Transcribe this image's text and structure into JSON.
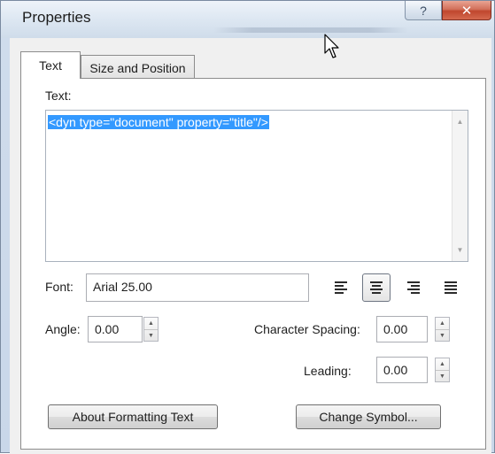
{
  "window": {
    "title": "Properties",
    "help_glyph": "?",
    "close_glyph": "✕"
  },
  "tabs": [
    {
      "label": "Text",
      "selected": true
    },
    {
      "label": "Size and Position",
      "selected": false
    }
  ],
  "text_section": {
    "label": "Text:",
    "value": "<dyn type=\"document\" property=\"title\"/>"
  },
  "font": {
    "label": "Font:",
    "value": "Arial 25.00"
  },
  "alignment": {
    "options": [
      "align-left",
      "align-center",
      "align-right",
      "align-justify"
    ],
    "selected": "align-center"
  },
  "angle": {
    "label": "Angle:",
    "value": "0.00"
  },
  "character_spacing": {
    "label": "Character Spacing:",
    "value": "0.00"
  },
  "leading": {
    "label": "Leading:",
    "value": "0.00"
  },
  "buttons": {
    "about_formatting": "About Formatting Text",
    "change_symbol": "Change Symbol..."
  },
  "colors": {
    "selection": "#3399ff",
    "close_button": "#c0462e"
  }
}
